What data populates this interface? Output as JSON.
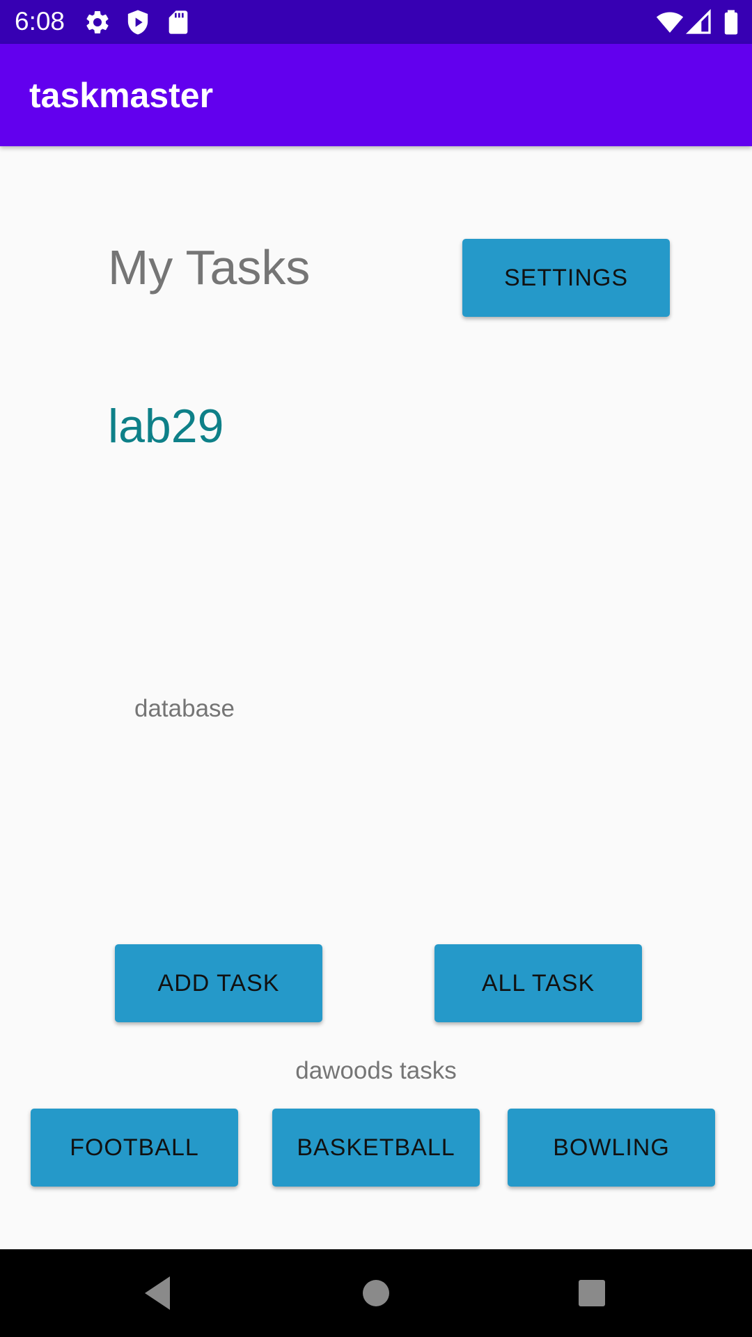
{
  "status_bar": {
    "time": "6:08",
    "left_icons": [
      "gear-icon",
      "shield-play-icon",
      "sd-card-icon"
    ],
    "right_icons": [
      "wifi-icon",
      "cell-signal-icon",
      "battery-icon"
    ],
    "background": "#3700B3"
  },
  "app_bar": {
    "title": "taskmaster",
    "background": "#6200EE"
  },
  "main": {
    "heading": "My Tasks",
    "settings_label": "SETTINGS",
    "username": "lab29",
    "database_label": "database",
    "add_task_label": "ADD TASK",
    "all_task_label": "ALL TASK",
    "section_label": "dawoods tasks",
    "tasks": [
      {
        "label": "FOOTBALL"
      },
      {
        "label": "BASKETBALL"
      },
      {
        "label": "BOWLING"
      }
    ],
    "button_color": "#2599C9",
    "username_color": "#0E8088"
  },
  "nav_bar": {
    "icons": [
      "back-icon",
      "home-icon",
      "recents-icon"
    ]
  }
}
